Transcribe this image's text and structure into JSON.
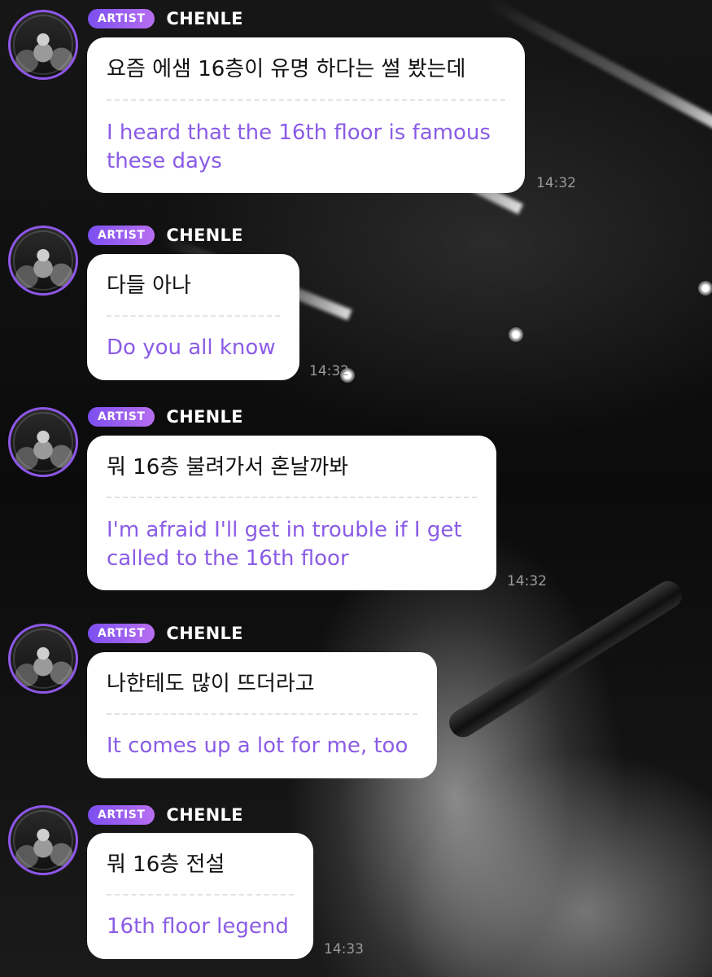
{
  "messages": [
    {
      "badge": "ARTIST",
      "name": "CHENLE",
      "korean": "요즘 에샘 16층이 유명 하다는 썰 봤는데",
      "english": "I heard that the 16th floor is famous these days",
      "time": "14:32"
    },
    {
      "badge": "ARTIST",
      "name": "CHENLE",
      "korean": "다들 아나",
      "english": "Do you all know",
      "time": "14:32"
    },
    {
      "badge": "ARTIST",
      "name": "CHENLE",
      "korean": "뭐 16층 불려가서 혼날까봐",
      "english": "I'm afraid I'll get in trouble if I get called to the 16th floor",
      "time": "14:32"
    },
    {
      "badge": "ARTIST",
      "name": "CHENLE",
      "korean": "나한테도 많이 뜨더라고",
      "english": "It comes up a lot for me, too",
      "time": ""
    },
    {
      "badge": "ARTIST",
      "name": "CHENLE",
      "korean": "뭐 16층 전설",
      "english": "16th floor legend",
      "time": "14:33"
    }
  ],
  "colors": {
    "badge_gradient_start": "#7b4ff0",
    "badge_gradient_end": "#b86ef0",
    "translation_text": "#8a5ce6",
    "bubble": "#ffffff"
  }
}
